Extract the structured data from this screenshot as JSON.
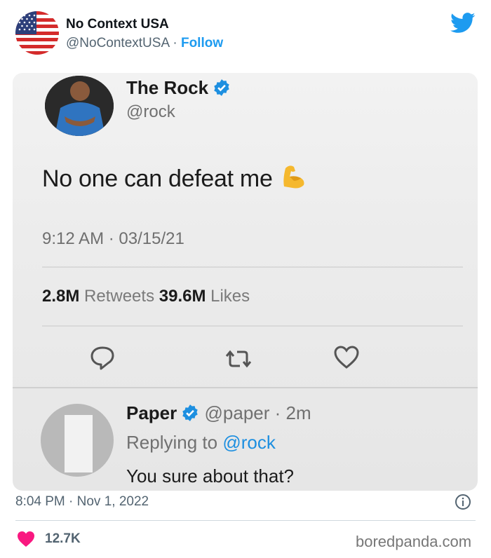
{
  "embed": {
    "account_name": "No Context USA",
    "handle": "@NoContextUSA",
    "separator": " · ",
    "follow_label": "Follow",
    "timestamp": "8:04 PM · Nov 1, 2022",
    "likes_count": "12.7K",
    "watermark": "boredpanda.com",
    "accent_color": "#1d9bf0",
    "heart_color": "#f91880"
  },
  "screenshot": {
    "original_tweet": {
      "author_name": "The Rock",
      "author_handle": "@rock",
      "text": "No one can defeat me",
      "emoji": "flexed-biceps",
      "time": "9:12 AM · 03/15/21",
      "retweets_count": "2.8M",
      "retweets_label": "Retweets",
      "likes_count": "39.6M",
      "likes_label": "Likes"
    },
    "reply": {
      "author_name": "Paper",
      "author_handle": "@paper",
      "age": "· 2m",
      "replying_prefix": "Replying to",
      "replying_to": "@rock",
      "text": "You sure about that?"
    }
  },
  "icons": [
    "us-flag-icon",
    "twitter-bird-icon",
    "verified-badge-icon",
    "flexed-biceps-icon",
    "reply-icon",
    "retweet-icon",
    "like-icon",
    "info-icon",
    "heart-icon"
  ]
}
